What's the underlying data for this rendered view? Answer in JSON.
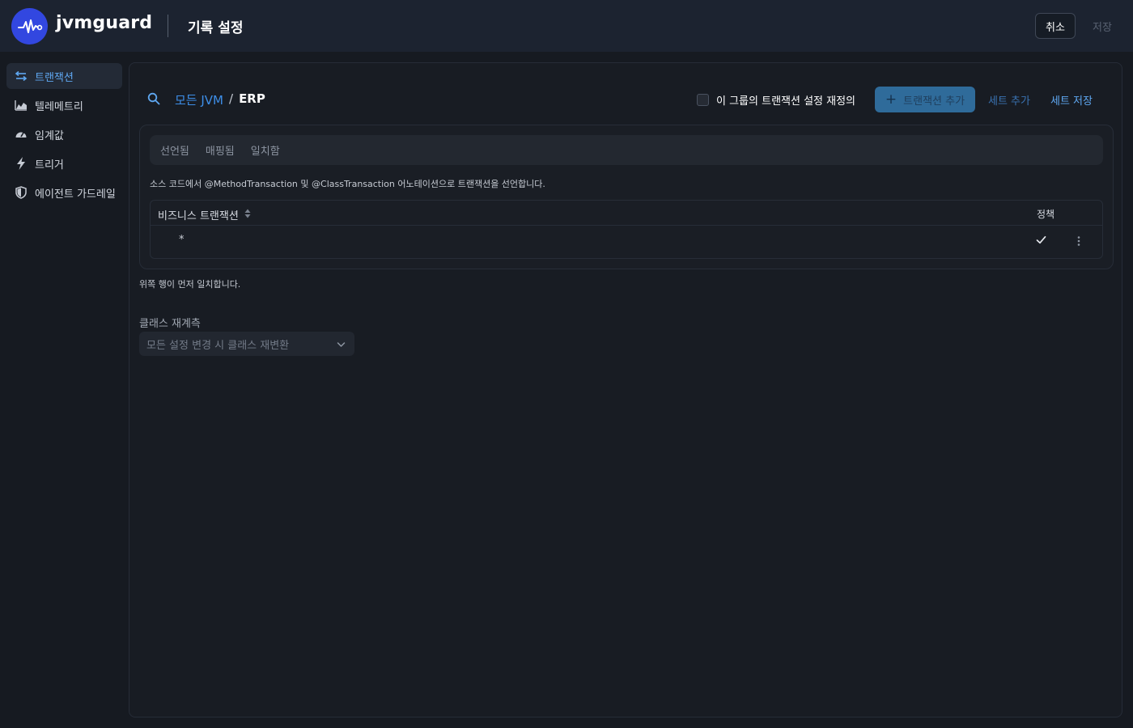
{
  "app": {
    "brand": "jvmguard",
    "page_title": "기록 설정"
  },
  "header": {
    "cancel_label": "취소",
    "save_label": "저장"
  },
  "sidebar": {
    "items": [
      {
        "label": "트랜잭션",
        "icon": "transactions-icon",
        "active": true
      },
      {
        "label": "텔레메트리",
        "icon": "chart-icon",
        "active": false
      },
      {
        "label": "임계값",
        "icon": "gauge-icon",
        "active": false
      },
      {
        "label": "트리거",
        "icon": "lightning-icon",
        "active": false
      },
      {
        "label": "에이전트 가드레일",
        "icon": "shield-icon",
        "active": false
      }
    ]
  },
  "main": {
    "breadcrumb": {
      "root": "모든 JVM",
      "separator": "/",
      "current": "ERP"
    },
    "override_label": "이 그룹의 트랜잭션 설정 재정의",
    "add_transaction_label": "트랜잭션 추가",
    "add_set_label": "세트 추가",
    "save_set_label": "세트 저장",
    "tabs": [
      "선언됨",
      "매핑됨",
      "일치함"
    ],
    "description": "소스 코드에서 @MethodTransaction 및 @ClassTransaction 어노테이션으로 트랜잭션을 선언합니다.",
    "table": {
      "col_business": "비즈니스 트랜잭션",
      "col_policy": "정책",
      "rows": [
        {
          "name": "*"
        }
      ]
    },
    "order_hint": "위쪽 행이 먼저 일치합니다.",
    "retransform_label": "클래스 재계측",
    "retransform_value": "모든 설정 변경 시 클래스 재변환"
  },
  "colors": {
    "accent": "#5fa8f2",
    "logo": "#3247e0",
    "header_bg": "#1c2330",
    "page_bg": "#161a21"
  }
}
